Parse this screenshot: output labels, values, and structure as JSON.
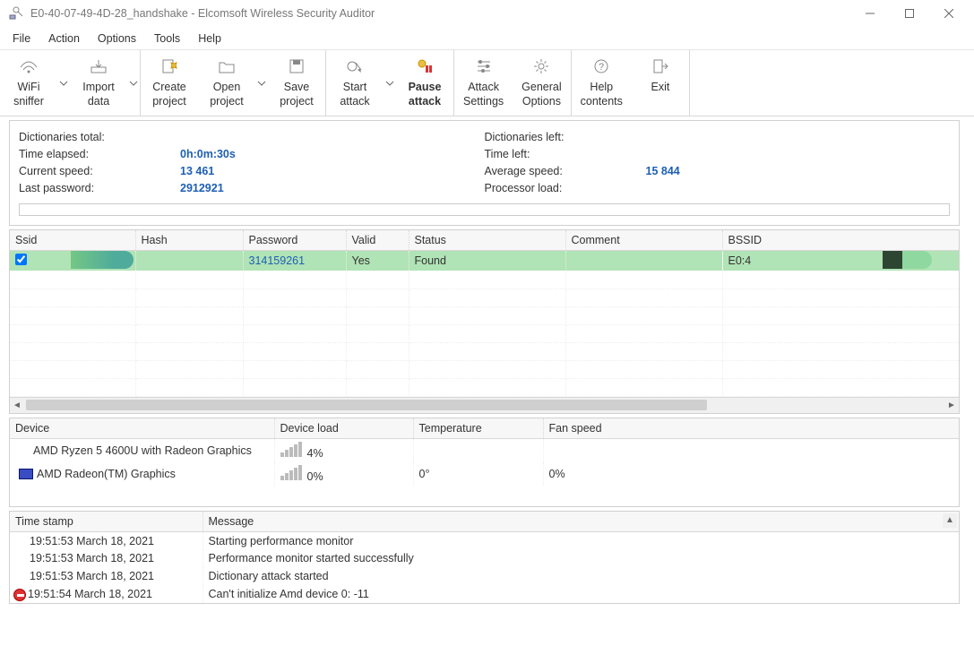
{
  "window": {
    "title": "E0-40-07-49-4D-28_handshake - Elcomsoft Wireless Security Auditor"
  },
  "menu": [
    "File",
    "Action",
    "Options",
    "Tools",
    "Help"
  ],
  "toolbar": {
    "wifi_sniffer": "WiFi\nsniffer",
    "import_data": "Import\ndata",
    "create_project": "Create\nproject",
    "open_project": "Open\nproject",
    "save_project": "Save\nproject",
    "start_attack": "Start\nattack",
    "pause_attack": "Pause\nattack",
    "attack_settings": "Attack\nSettings",
    "general_options": "General\nOptions",
    "help_contents": "Help\ncontents",
    "exit": "Exit"
  },
  "stats": {
    "left": {
      "dict_total_label": "Dictionaries total:",
      "dict_total_value": "",
      "time_elapsed_label": "Time elapsed:",
      "time_elapsed_value": "0h:0m:30s",
      "current_speed_label": "Current speed:",
      "current_speed_value": "13 461",
      "last_password_label": "Last password:",
      "last_password_value": "2912921"
    },
    "right": {
      "dict_left_label": "Dictionaries left:",
      "dict_left_value": "",
      "time_left_label": "Time left:",
      "time_left_value": "",
      "avg_speed_label": "Average speed:",
      "avg_speed_value": "15 844",
      "proc_load_label": "Processor load:",
      "proc_load_value": ""
    }
  },
  "table": {
    "headers": [
      "Ssid",
      "Hash",
      "Password",
      "Valid",
      "Status",
      "Comment",
      "BSSID"
    ],
    "row": {
      "ssid": "",
      "hash": "",
      "password": "314159261",
      "valid": "Yes",
      "status": "Found",
      "comment": "",
      "bssid": "E0:4"
    }
  },
  "devices": {
    "headers": [
      "Device",
      "Device load",
      "Temperature",
      "Fan speed"
    ],
    "rows": [
      {
        "name": "AMD Ryzen 5 4600U with Radeon Graphics",
        "load": "4%",
        "temp": "",
        "fan": ""
      },
      {
        "name": "AMD Radeon(TM) Graphics",
        "load": "0%",
        "temp": "0°",
        "fan": "0%"
      }
    ]
  },
  "log": {
    "headers": [
      "Time stamp",
      "Message"
    ],
    "rows": [
      {
        "ts": "19:51:53 March 18, 2021",
        "msg": "Starting performance monitor"
      },
      {
        "ts": "19:51:53 March 18, 2021",
        "msg": "Performance monitor started successfully"
      },
      {
        "ts": "19:51:53 March 18, 2021",
        "msg": "Dictionary attack started"
      },
      {
        "ts": "19:51:54 March 18, 2021",
        "msg": "Can't initialize Amd device 0: -11",
        "error": true
      }
    ]
  }
}
